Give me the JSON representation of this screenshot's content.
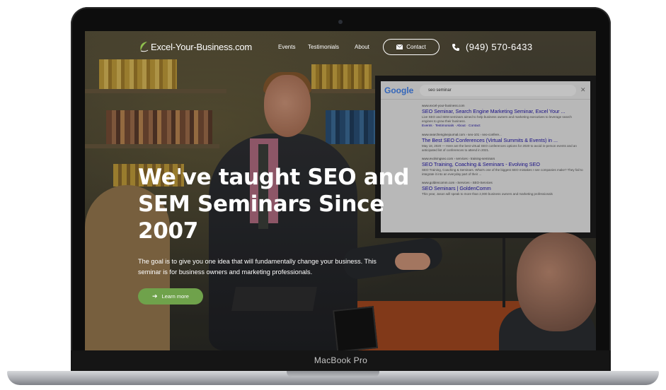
{
  "device": {
    "label": "MacBook Pro"
  },
  "nav": {
    "brand": "Excel-Your-Business.com",
    "links": [
      "Events",
      "Testimonials",
      "About"
    ],
    "contact_label": "Contact",
    "phone": "(949) 570-6433"
  },
  "hero": {
    "title": "We've taught SEO and SEM Seminars Since 2007",
    "subtitle": "The goal is to give you one idea that will fundamentally change your business. This seminar is for business owners and marketing professionals.",
    "cta_label": "Learn more"
  },
  "serp": {
    "logo": "Google",
    "query": "seo seminar",
    "results": [
      {
        "url": "www.excel-your-business.com",
        "title": "SEO Seminar, Search Engine Marketing Seminar, Excel Your ...",
        "snippet": "Live SEO and SEM seminars aimed to help business owners and marketing executives to leverage search engines to grow their business.",
        "links": "Events · Testimonials · About · Contact"
      },
      {
        "url": "www.searchenginejournal.com › seo-101 › seo-confere...",
        "title": "The Best SEO Conferences (Virtual Summits & Events) in ...",
        "snippet": "May 18, 2020 — Here are the best virtual SEO conferences options for 2020 to avoid in-person events and an anticipated list of conferences to attend in 2021.",
        "links": ""
      },
      {
        "url": "www.evolvingseo.com › services › training-seminars",
        "title": "SEO Training, Coaching & Seminars - Evolving SEO",
        "snippet": "SEO Training, Coaching & Seminars. What's one of the biggest SEO mistakes I see companies make? They fail to integrate it into an everyday part of their ...",
        "links": ""
      },
      {
        "url": "www.goldencomm.com › Services › SEO-Services",
        "title": "SEO Seminars | GoldenComm",
        "snippet": "This year, Jason will speak to more than 2,000 business owners and marketing professionals",
        "links": ""
      }
    ]
  },
  "colors": {
    "accent_green": "#6fa24b",
    "link_blue": "#1a0dab",
    "white": "#ffffff"
  },
  "icons": {
    "brand": "swoosh-logo-icon",
    "contact": "envelope-icon",
    "phone": "phone-icon",
    "cta": "arrow-right-icon",
    "close": "close-icon"
  }
}
